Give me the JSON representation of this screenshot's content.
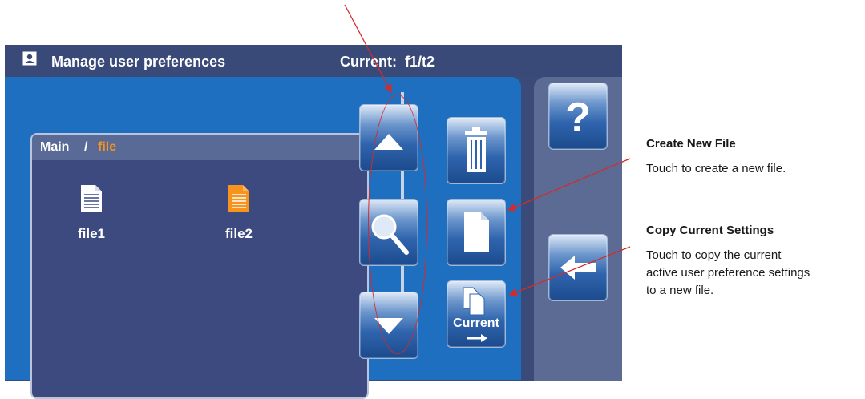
{
  "header": {
    "title": "Manage user preferences",
    "current_label": "Current:  f1/t2"
  },
  "breadcrumb": {
    "root": "Main",
    "separator": "/",
    "current": "file"
  },
  "files": [
    {
      "name": "file1",
      "color": "#ffffff"
    },
    {
      "name": "file2",
      "color": "#f7941d"
    }
  ],
  "buttons": {
    "current_label": "Current"
  },
  "callouts": {
    "create": {
      "title": "Create New File",
      "text": "Touch to create a new file."
    },
    "copy": {
      "title": "Copy Current Settings",
      "line1": "Touch to copy the current",
      "line2": "active user preference settings",
      "line3": "to a new file."
    }
  },
  "colors": {
    "accent_orange": "#f7941d",
    "panel_blue": "#1f6fc0",
    "annotation_red": "#d62a2a"
  }
}
